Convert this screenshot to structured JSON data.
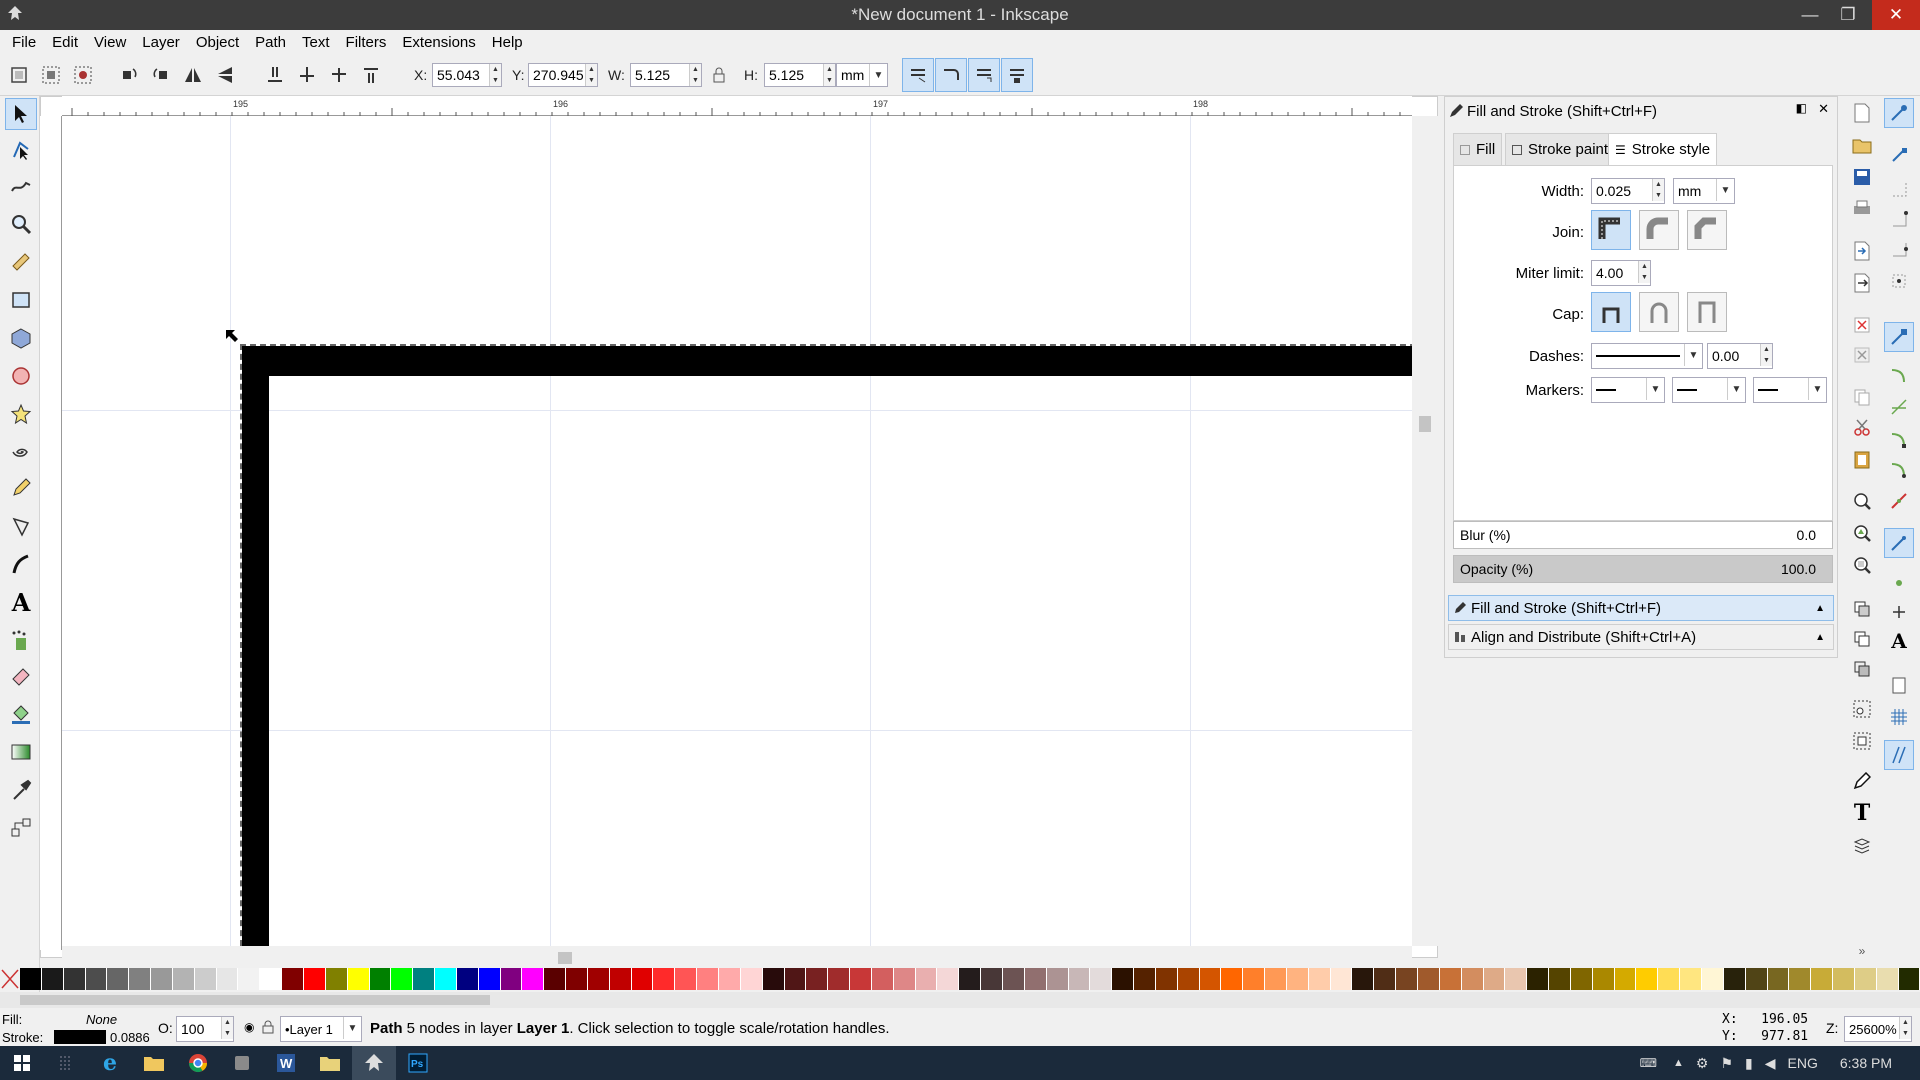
{
  "window": {
    "title": "*New document 1 - Inkscape",
    "close_icon": "✕",
    "maximize_icon": "❐",
    "minimize_icon": "—"
  },
  "menu": [
    "File",
    "Edit",
    "View",
    "Layer",
    "Object",
    "Path",
    "Text",
    "Filters",
    "Extensions",
    "Help"
  ],
  "controls": {
    "x_label": "X:",
    "x_value": "55.043",
    "y_label": "Y:",
    "y_value": "270.945",
    "w_label": "W:",
    "w_value": "5.125",
    "h_label": "H:",
    "h_value": "5.125",
    "unit": "mm"
  },
  "rulers": {
    "h_ticks": [
      "195",
      "196",
      "197",
      "198"
    ]
  },
  "dock": {
    "title": "Fill and Stroke (Shift+Ctrl+F)",
    "tabs": [
      "Fill",
      "Stroke paint",
      "Stroke style"
    ],
    "stroke_style": {
      "width_label": "Width:",
      "width_value": "0.025",
      "width_unit": "mm",
      "join_label": "Join:",
      "miter_label": "Miter limit:",
      "miter_value": "4.00",
      "cap_label": "Cap:",
      "dashes_label": "Dashes:",
      "dash_offset": "0.00",
      "markers_label": "Markers:"
    },
    "blur_label": "Blur (%)",
    "blur_value": "0.0",
    "opacity_label": "Opacity (%)",
    "opacity_value": "100.0",
    "panels": [
      "Fill and Stroke (Shift+Ctrl+F)",
      "Align and Distribute (Shift+Ctrl+A)"
    ]
  },
  "palette": [
    "#000000",
    "#1a1a1a",
    "#333333",
    "#4d4d4d",
    "#666666",
    "#808080",
    "#999999",
    "#b3b3b3",
    "#cccccc",
    "#e6e6e6",
    "#f2f2f2",
    "#ffffff",
    "#800000",
    "#ff0000",
    "#808000",
    "#ffff00",
    "#008000",
    "#00ff00",
    "#008080",
    "#00ffff",
    "#000080",
    "#0000ff",
    "#800080",
    "#ff00ff",
    "#5a0000",
    "#7f0000",
    "#a00000",
    "#c00000",
    "#e00000",
    "#ff2a2a",
    "#ff5555",
    "#ff8080",
    "#ffaaaa",
    "#ffd5d5",
    "#280b0b",
    "#501616",
    "#782121",
    "#a02c2c",
    "#c83737",
    "#d35f5f",
    "#de8787",
    "#e9afaf",
    "#f4d7d7",
    "#241c1c",
    "#483737",
    "#6c5353",
    "#916f6f",
    "#ac9393",
    "#c8b7b7",
    "#e3dbdb",
    "#2b1100",
    "#552200",
    "#803300",
    "#aa4400",
    "#d45500",
    "#ff6600",
    "#ff7f2a",
    "#ff9955",
    "#ffb380",
    "#ffccaa",
    "#ffe6d5",
    "#28170b",
    "#502d16",
    "#784421",
    "#a05a2c",
    "#c87137",
    "#d38d5f",
    "#deaa87",
    "#e9c6af",
    "#2b2200",
    "#554400",
    "#806600",
    "#aa8800",
    "#d4aa00",
    "#ffcc00",
    "#ffdd55",
    "#ffe680",
    "#fff6d5",
    "#28220b",
    "#504416",
    "#786721",
    "#a0892c",
    "#c8ab37",
    "#d3bc5f",
    "#decd87",
    "#e9ddaf",
    "#222b00"
  ],
  "status": {
    "fill_label": "Fill:",
    "fill_value": "None",
    "stroke_label": "Stroke:",
    "stroke_width": "0.0886",
    "opacity_label": "O:",
    "opacity_value": "100",
    "layer": "•Layer 1",
    "message_prefix": "Path",
    "message_body": " 5 nodes in layer ",
    "message_layer": "Layer 1",
    "message_suffix": ". Click selection to toggle scale/rotation handles.",
    "x_readout": "X:   196.05",
    "y_readout": "Y:   977.81",
    "zoom_label": "Z:",
    "zoom": "25600%"
  },
  "taskbar": {
    "lang": "ENG",
    "time": "6:38 PM"
  }
}
